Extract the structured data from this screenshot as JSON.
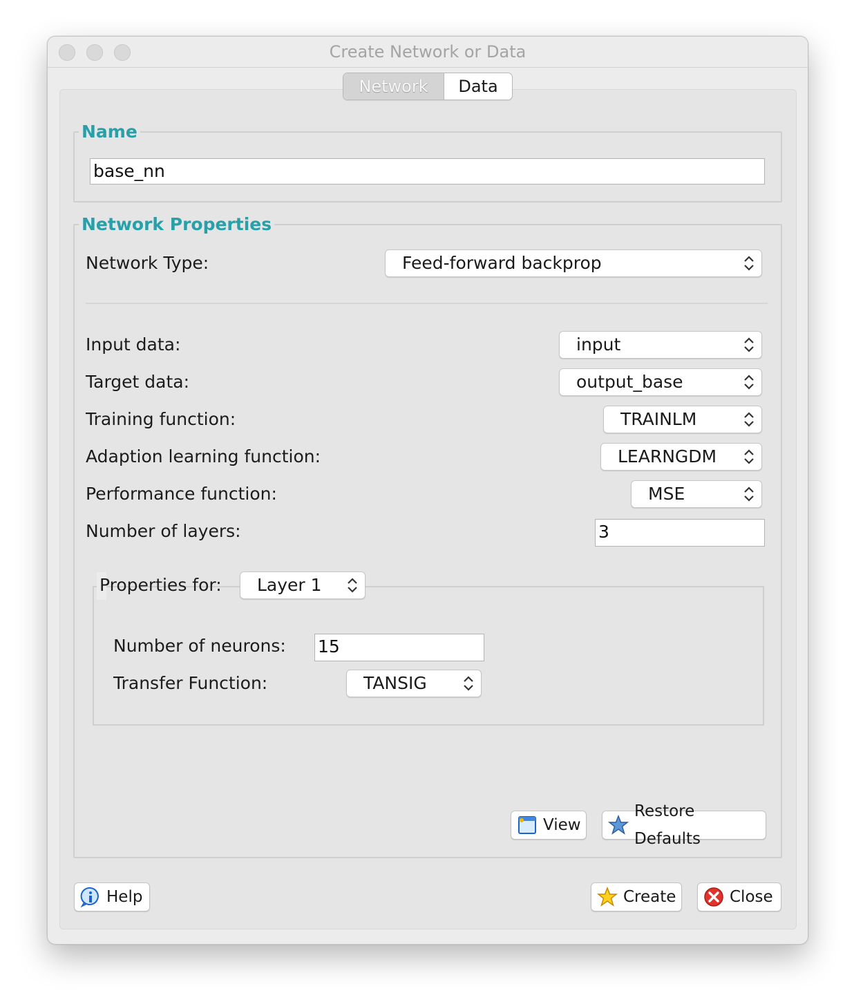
{
  "window": {
    "title": "Create Network or Data"
  },
  "tabs": [
    {
      "label": "Network",
      "selected": false
    },
    {
      "label": "Data",
      "selected": true
    }
  ],
  "name_group": {
    "legend": "Name",
    "value": "base_nn"
  },
  "props_group": {
    "legend": "Network Properties",
    "network_type": {
      "label": "Network Type:",
      "value": "Feed-forward backprop"
    },
    "input_data": {
      "label": "Input data:",
      "value": "input"
    },
    "target_data": {
      "label": "Target data:",
      "value": "output_base"
    },
    "training_function": {
      "label": "Training function:",
      "value": "TRAINLM"
    },
    "adaption_function": {
      "label": "Adaption learning function:",
      "value": "LEARNGDM"
    },
    "performance_function": {
      "label": "Performance function:",
      "value": "MSE"
    },
    "num_layers": {
      "label": "Number of layers:",
      "value": "3"
    },
    "layer_props": {
      "label": "Properties for:",
      "layer": "Layer 1",
      "neurons": {
        "label": "Number of neurons:",
        "value": "15"
      },
      "transfer": {
        "label": "Transfer Function:",
        "value": "TANSIG"
      }
    },
    "view_button": "View",
    "restore_button": "Restore Defaults"
  },
  "footer": {
    "help_button": "Help",
    "create_button": "Create",
    "close_button": "Close"
  },
  "colors": {
    "legend": "#2a9fa8",
    "window_bg": "#ececec"
  },
  "icons": [
    "view-window-icon",
    "restore-star-icon",
    "help-info-icon",
    "create-star-icon",
    "close-x-icon"
  ]
}
